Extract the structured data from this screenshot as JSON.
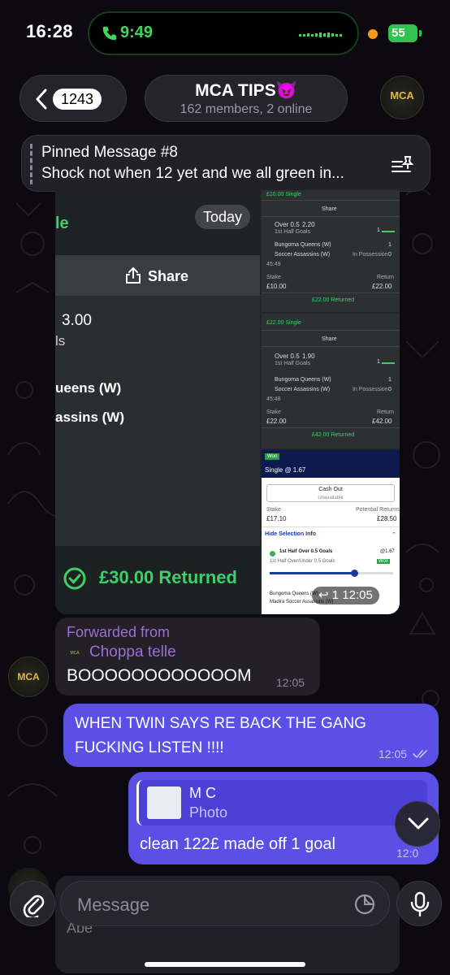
{
  "status_bar": {
    "time": "16:28",
    "call_time": "9:49",
    "battery": "55"
  },
  "header": {
    "back_count": "1243",
    "title": "MCA TIPS😈",
    "subtitle": "162 members, 2 online",
    "avatar_text": "MCA"
  },
  "pinned": {
    "title": "Pinned Message #8",
    "text": "Shock not when 12 yet and we all green in..."
  },
  "image_message": {
    "left_shot": {
      "title_fragment": "le",
      "date_badge": "Today",
      "share_label": "Share",
      "odds": "3.00",
      "market_fragment": "ls",
      "team1": "ueens (W)",
      "team2": "assins (W)",
      "returned": "£30.00  Returned"
    },
    "bet1": {
      "header": "£10.00 Single",
      "share": "Share",
      "selection": "Over 0.5",
      "odds": "2.20",
      "market": "1st Half Goals",
      "score_label": "1",
      "team1": "Bungoma Queens (W)",
      "team1_score": "1",
      "team2": "Soccer Assassins (W)",
      "team2_status": "In Possession",
      "team2_score": "0",
      "clock": "45:49",
      "stake_label": "Stake",
      "stake": "£10.00",
      "return_label": "Return",
      "return": "£22.00",
      "returned": "£22.00 Returned"
    },
    "bet2": {
      "header": "£22.00 Single",
      "share": "Share",
      "selection": "Over 0.5",
      "odds": "1.90",
      "market": "1st Half Goals",
      "score_label": "1",
      "team1": "Bungoma Queens (W)",
      "team1_score": "1",
      "team2": "Soccer Assassins (W)",
      "team2_status": "In Possession",
      "team2_score": "0",
      "clock": "45:48",
      "stake_label": "Stake",
      "stake": "£22.00",
      "return_label": "Return",
      "return": "£42.00",
      "returned": "£42.00 Returned"
    },
    "bet3": {
      "won_badge": "Won",
      "single": "Single @ 1.67",
      "cash_out": "Cash Out",
      "cash_out_sub": "Unavailable",
      "stake_label": "Stake",
      "stake": "£17.10",
      "potential_label": "Potential Returns",
      "potential": "£28.50",
      "hide_selection": "Hide Selection Info",
      "selection": "1st Half Over 0.5 Goals",
      "selection_odds": "@1.67",
      "selection_market": "1st Half Over/Under 0.5 Goals",
      "selection_won": "Won",
      "team1": "Bungoma Queens (W)",
      "team2": "Madira Soccer Assassins (W)"
    },
    "reply_count": "1",
    "time": "12:05"
  },
  "messages": {
    "forwarded": {
      "avatar_text": "MCA",
      "forwarded_label": "Forwarded from",
      "from_avatar_text": "MCA",
      "from_name": "Choppa telle",
      "text": "BOOOOOOOOOOOOM",
      "time": "12:05"
    },
    "out1": {
      "text": "WHEN TWIN SAYS RE BACK THE GANG FUCKING LISTEN !!!!",
      "time": "12:05"
    },
    "out2": {
      "quote_name": "M C",
      "quote_sub": "Photo",
      "text": "clean 122£ made off 1 goal",
      "time": "12:0"
    },
    "peek_name": "Abe"
  },
  "input": {
    "placeholder": "Message"
  },
  "colors": {
    "accent": "#5b50e6",
    "green": "#3fcf68",
    "forward_purple": "#9b6fd4"
  }
}
